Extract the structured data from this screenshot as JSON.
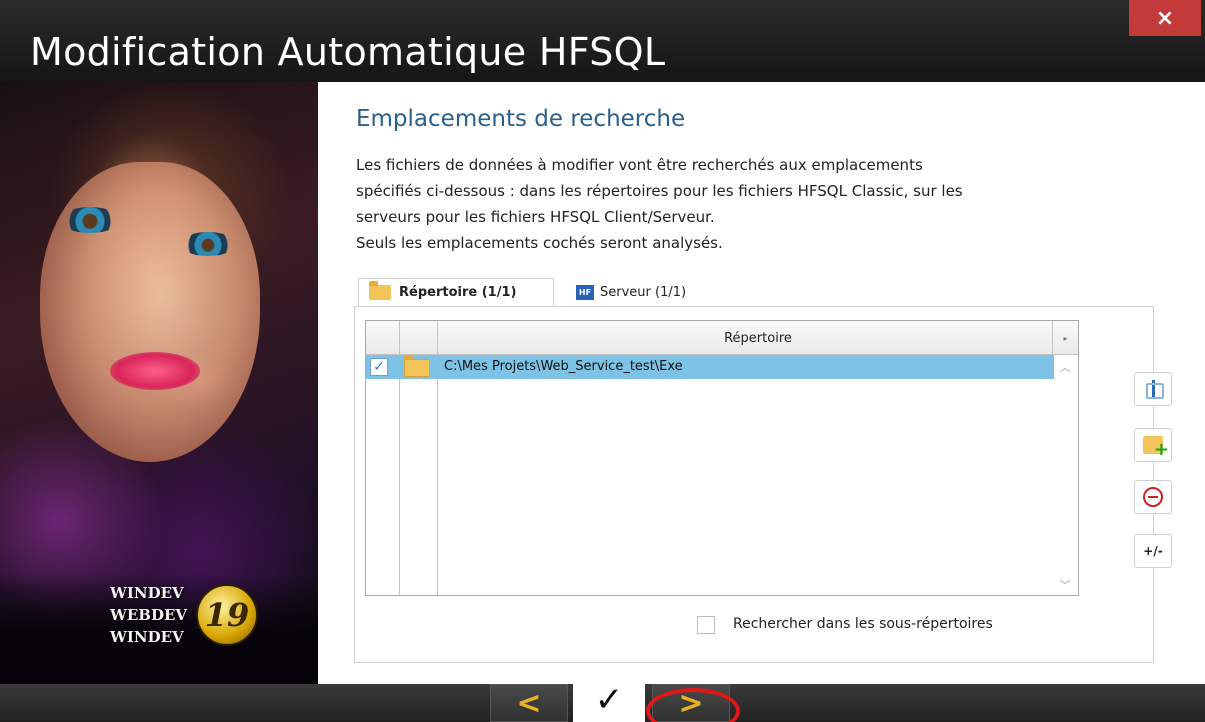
{
  "window": {
    "title": "Modification Automatique HFSQL",
    "close_label": "×"
  },
  "promo": {
    "brand_lines": [
      "WINDEV",
      "WEBDEV",
      "WINDEV"
    ],
    "badge": "19"
  },
  "content": {
    "heading": "Emplacements de recherche",
    "description_lines": [
      "Les fichiers de données à modifier vont être recherchés aux emplacements",
      "spécifiés ci-dessous : dans les répertoires pour les fichiers HFSQL Classic, sur les",
      "serveurs pour les fichiers HFSQL Client/Serveur.",
      "Seuls les emplacements cochés seront analysés."
    ],
    "tabs": [
      {
        "label": "Répertoire (1/1)",
        "icon": "folder-icon",
        "active": true
      },
      {
        "label": "Serveur (1/1)",
        "icon": "hf-icon",
        "icon_text": "HF",
        "active": false
      }
    ],
    "table": {
      "column_header": "Répertoire",
      "rows": [
        {
          "checked": true,
          "path": "C:\\Mes Projets\\Web_Service_test\\Exe",
          "selected": true
        }
      ]
    },
    "subdirectories": {
      "label": "Rechercher dans les sous-répertoires",
      "checked": false
    },
    "side_buttons": [
      {
        "name": "edit-button",
        "icon": "edit-icon"
      },
      {
        "name": "add-folder-button",
        "icon": "add-folder-icon"
      },
      {
        "name": "remove-button",
        "icon": "remove-icon"
      },
      {
        "name": "toggle-check-button",
        "label": "+/-"
      }
    ]
  },
  "navigation": {
    "prev_symbol": "<",
    "finish_symbol": "✓",
    "next_symbol": ">"
  },
  "colors": {
    "heading": "#2a5f8c",
    "selected_row": "#7ec3e6",
    "close_button": "#c23a3a",
    "nav_arrow": "#e8b227",
    "highlight": "#e01818"
  }
}
